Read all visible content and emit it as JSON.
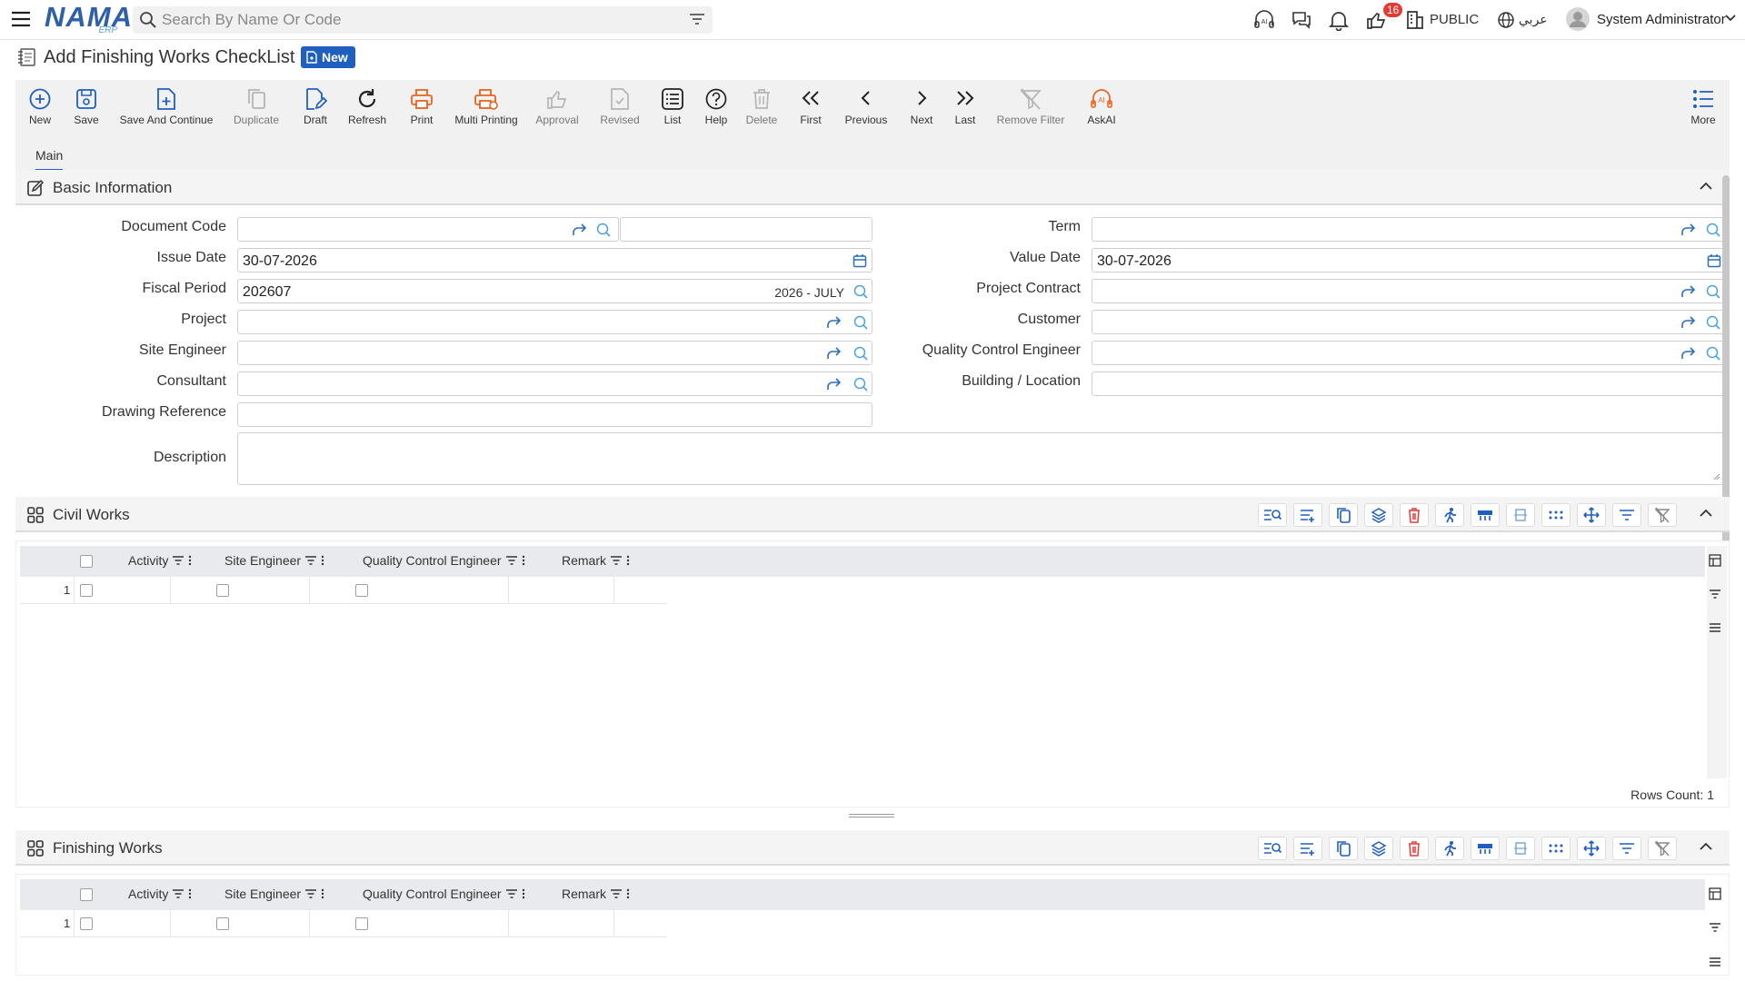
{
  "header": {
    "logo_text": "NAMA",
    "logo_sub": "ERP",
    "search_placeholder": "Search By Name Or Code",
    "notification_count": "16",
    "public_label": "PUBLIC",
    "language_label": "عربي",
    "user_name": "System Administrator"
  },
  "page": {
    "title": "Add Finishing Works CheckList",
    "status_badge": "New"
  },
  "toolbar": {
    "new": "New",
    "save": "Save",
    "save_continue": "Save And Continue",
    "duplicate": "Duplicate",
    "draft": "Draft",
    "refresh": "Refresh",
    "print": "Print",
    "multi_printing": "Multi Printing",
    "approval": "Approval",
    "revised": "Revised",
    "list": "List",
    "help": "Help",
    "delete": "Delete",
    "first": "First",
    "previous": "Previous",
    "next": "Next",
    "last": "Last",
    "remove_filter": "Remove Filter",
    "askai": "AskAI",
    "more": "More"
  },
  "tabs": {
    "main": "Main"
  },
  "basic_info": {
    "title": "Basic Information",
    "labels": {
      "document_code": "Document Code",
      "issue_date": "Issue Date",
      "fiscal_period": "Fiscal Period",
      "project": "Project",
      "site_engineer": "Site Engineer",
      "consultant": "Consultant",
      "drawing_reference": "Drawing Reference",
      "description": "Description",
      "term": "Term",
      "value_date": "Value Date",
      "project_contract": "Project Contract",
      "customer": "Customer",
      "quality_control_engineer": "Quality Control Engineer",
      "building_location": "Building / Location"
    },
    "values": {
      "issue_date": "30-07-2026",
      "fiscal_period": "202607",
      "fiscal_period_extra": "2026 - JULY",
      "value_date": "30-07-2026"
    }
  },
  "civil_works": {
    "title": "Civil Works",
    "columns": [
      "Activity",
      "Site Engineer",
      "Quality Control Engineer",
      "Remark"
    ],
    "row_number": "1",
    "rows_count": "Rows Count: 1"
  },
  "finishing_works": {
    "title": "Finishing Works",
    "columns": [
      "Activity",
      "Site Engineer",
      "Quality Control Engineer",
      "Remark"
    ],
    "row_number": "1"
  },
  "colors": {
    "primary": "#1f5fbf",
    "orange": "#e8631c",
    "disabled": "#b5b5b5",
    "delete_red": "#e53935",
    "toolbar_bg": "#f1f1f2"
  }
}
